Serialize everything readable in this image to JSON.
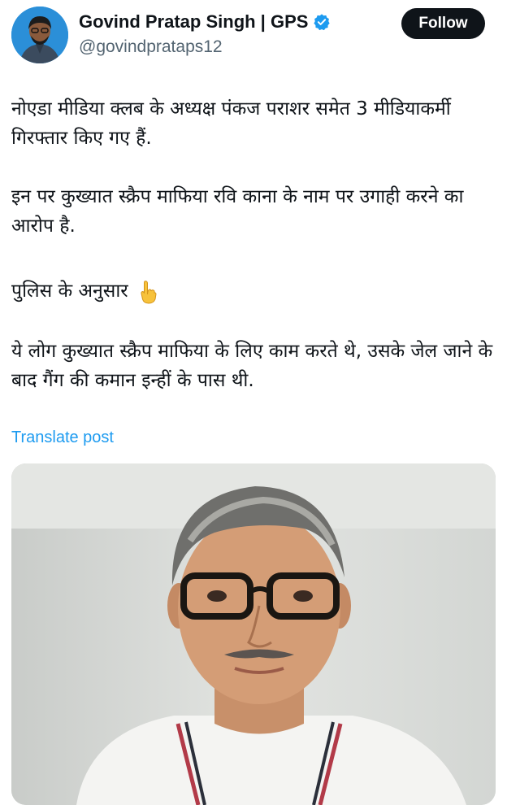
{
  "author": {
    "display_name": "Govind Pratap Singh | GPS",
    "handle": "@govindprataps12",
    "verified": true,
    "avatar_icon": "avatar-person-icon"
  },
  "follow_button": {
    "label": "Follow"
  },
  "post": {
    "paragraphs": [
      "नोएडा मीडिया क्लब के अध्यक्ष पंकज पराशर समेत 3 मीडियाकर्मी गिरफ्तार किए गए हैं.",
      "इन पर कुख्यात स्क्रैप माफिया रवि काना के नाम पर उगाही करने का आरोप है.",
      "पुलिस के अनुसार",
      "ये लोग कुख्यात स्क्रैप माफिया के लिए काम करते थे, उसके जेल जाने के बाद गैंग की कमान इन्हीं के पास थी."
    ],
    "emoji_icon": "pointing-down-hand-icon",
    "translate_link": "Translate post",
    "media_icon": "man-portrait-photo"
  },
  "colors": {
    "accent": "#1d9bf0",
    "text": "#0f1419",
    "secondary": "#536471",
    "follow_bg": "#0f1419"
  }
}
